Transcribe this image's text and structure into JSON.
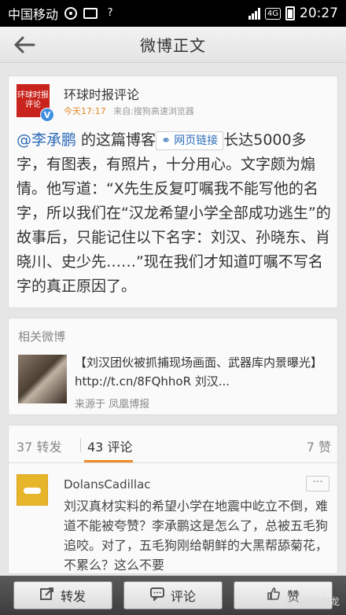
{
  "statusbar": {
    "carrier": "中国移动",
    "network": "4G",
    "time": "20:27"
  },
  "header": {
    "title": "微博正文"
  },
  "post": {
    "author": "环球时报评论",
    "avatar_text_top": "环球时报",
    "avatar_text_bottom": "评论",
    "verified_badge": "V",
    "time": "今天17:17",
    "source": "来自:搜狗高速浏览器",
    "mention": "@李承鹏",
    "text_before_link": " 的这篇博客",
    "link_label": "网页链接",
    "text_after_link": "长达5000多字，有图表，有照片，十分用心。文字颇为煽情。他写道：“X先生反复叮嘱我不能写他的名字，所以我们在“汉龙希望小学全部成功逃生”的故事后，只能记住以下名字：刘汉、孙晓东、肖晓川、史少先……”现在我们才知道叮嘱不写名字的真正原因了。"
  },
  "related": {
    "label": "相关微博",
    "title": "【刘汉团伙被抓捕现场画面、武器库内景曝光】http://t.cn/8FQhhoR 刘汉...",
    "source": "来源于 凤凰博报"
  },
  "comments": {
    "reposts_tab": "37 转发",
    "comments_tab": "43 评论",
    "likes_tab": "7 赞",
    "first": {
      "name": "DolansCadillac",
      "more": "···",
      "text": "刘汉真材实料的希望小学在地震中屹立不倒，难道不能被夸赞？李承鹏这是怎么了，总被五毛狗追咬。对了，五毛狗刚给朝鲜的大黑帮舔菊花，不累么？这么不要"
    }
  },
  "bottombar": {
    "repost": "转发",
    "comment": "评论",
    "like": "赞"
  },
  "watermark": "@成都凤舞龙"
}
